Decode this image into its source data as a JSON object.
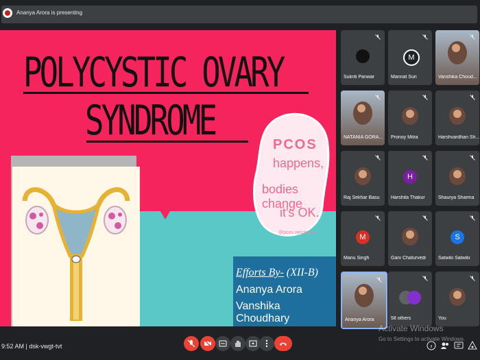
{
  "header": {
    "presenting_text": "Ananya Arora is presenting"
  },
  "slide": {
    "title_line1": "POLYCYSTIC OVARY",
    "title_line2": "SYNDROME",
    "pcos": {
      "word": "PCOS",
      "line2": "happens,",
      "line3": "bodies change",
      "line4": "it's OK.",
      "tag": "@pcos.weightloss"
    },
    "efforts": {
      "label": "Efforts By-",
      "class": "(XII-B)",
      "name1": "Ananya Arora",
      "name2": "Vanshika Choudhary"
    },
    "colors": {
      "background": "#f5245d",
      "teal": "#5bc8c8",
      "box": "#1f6f9e"
    }
  },
  "participants": [
    {
      "name": "Sukriti Panwar",
      "avatar": "dark-avatar",
      "letter": ""
    },
    {
      "name": "Mannat Suri",
      "avatar": "letter-avatar",
      "letter": "M"
    },
    {
      "name": "Vanshika Choud...",
      "avatar": "video",
      "letter": ""
    },
    {
      "name": "NATANIA GORA...",
      "avatar": "video",
      "letter": ""
    },
    {
      "name": "Pronoy Mitra",
      "avatar": "photo",
      "letter": ""
    },
    {
      "name": "Harshvardhan Sh...",
      "avatar": "photo",
      "letter": ""
    },
    {
      "name": "Raj Sekhar Basu",
      "avatar": "photo",
      "letter": ""
    },
    {
      "name": "Harshita Thakur",
      "avatar": "letter-avatar",
      "letter": "H"
    },
    {
      "name": "Shaurya Sharma",
      "avatar": "photo",
      "letter": ""
    },
    {
      "name": "Manu Singh",
      "avatar": "letter-avatar",
      "letter": "M"
    },
    {
      "name": "Garv Chaturvedi",
      "avatar": "photo",
      "letter": ""
    },
    {
      "name": "Satwiki Satwiki",
      "avatar": "letter-avatar",
      "letter": "S"
    },
    {
      "name": "Ananya Arora",
      "avatar": "video",
      "letter": ""
    },
    {
      "name": "58 others",
      "avatar": "group",
      "letter": ""
    },
    {
      "name": "You",
      "avatar": "photo",
      "letter": ""
    }
  ],
  "footer": {
    "time_code": "9:52 AM | dsk-vwgt-tvt",
    "activate_line1": "Activate Windows",
    "activate_line2": "Go to Settings to activate Windows."
  },
  "colors": {
    "app_bg": "#202124",
    "tile_bg": "#3c4043",
    "red": "#ea4335"
  }
}
